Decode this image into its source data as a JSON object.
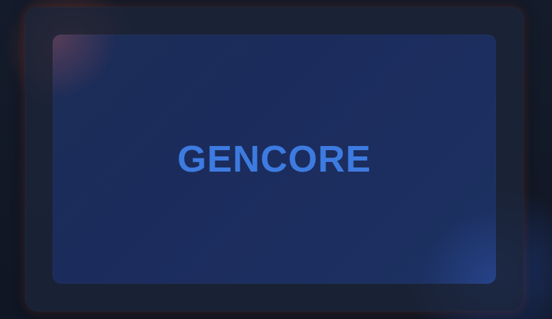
{
  "brand": {
    "wordmark": "GENCORE",
    "wordmark_color": "#3d7be0",
    "card_color": "#1c2d57",
    "frame_color": "#1c253a",
    "background_color": "#121826",
    "accent_warm": "#e25c3a",
    "accent_cool": "#3060dc"
  }
}
